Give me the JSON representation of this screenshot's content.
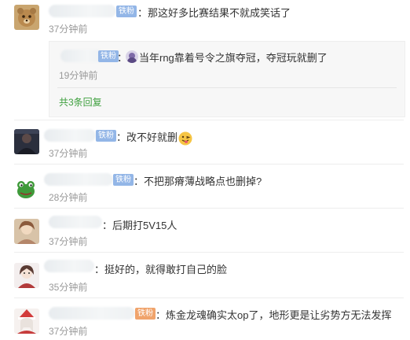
{
  "comments": [
    {
      "content": "那这好多比赛结果不就成笑话了",
      "badge": "铁粉",
      "time": "37分钟前",
      "reply": {
        "badge": "铁粉",
        "content": "当年rng靠着号令之旗夺冠，夺冠玩就删了",
        "time": "19分钟前",
        "more_label": "共3条回复"
      }
    },
    {
      "content": "改不好就删",
      "badge": "铁粉",
      "time": "37分钟前"
    },
    {
      "content": "不把那瘠薄战略点也删掉?",
      "badge": "铁粉",
      "time": "28分钟前"
    },
    {
      "content": "后期打5V15人",
      "time": "37分钟前"
    },
    {
      "content": "挺好的，就得敢打自己的脸",
      "time": "35分钟前"
    },
    {
      "content": "炼金龙魂确实太op了，地形更是让劣势方无法发挥",
      "badge": "铁粉",
      "time": "37分钟前"
    }
  ],
  "icons": {
    "c1_avatar": "bear-avatar-icon",
    "c2_avatar": "person-dark-avatar-icon",
    "c3_avatar": "frog-avatar-icon",
    "c4_avatar": "anime-girl-avatar-icon",
    "c5_avatar": "anime-character-avatar-icon",
    "c6_avatar": "christmas-girl-avatar-icon",
    "reply_avatar": "mini-avatar-icon",
    "emoji": "tongue-out-emoji-icon"
  }
}
